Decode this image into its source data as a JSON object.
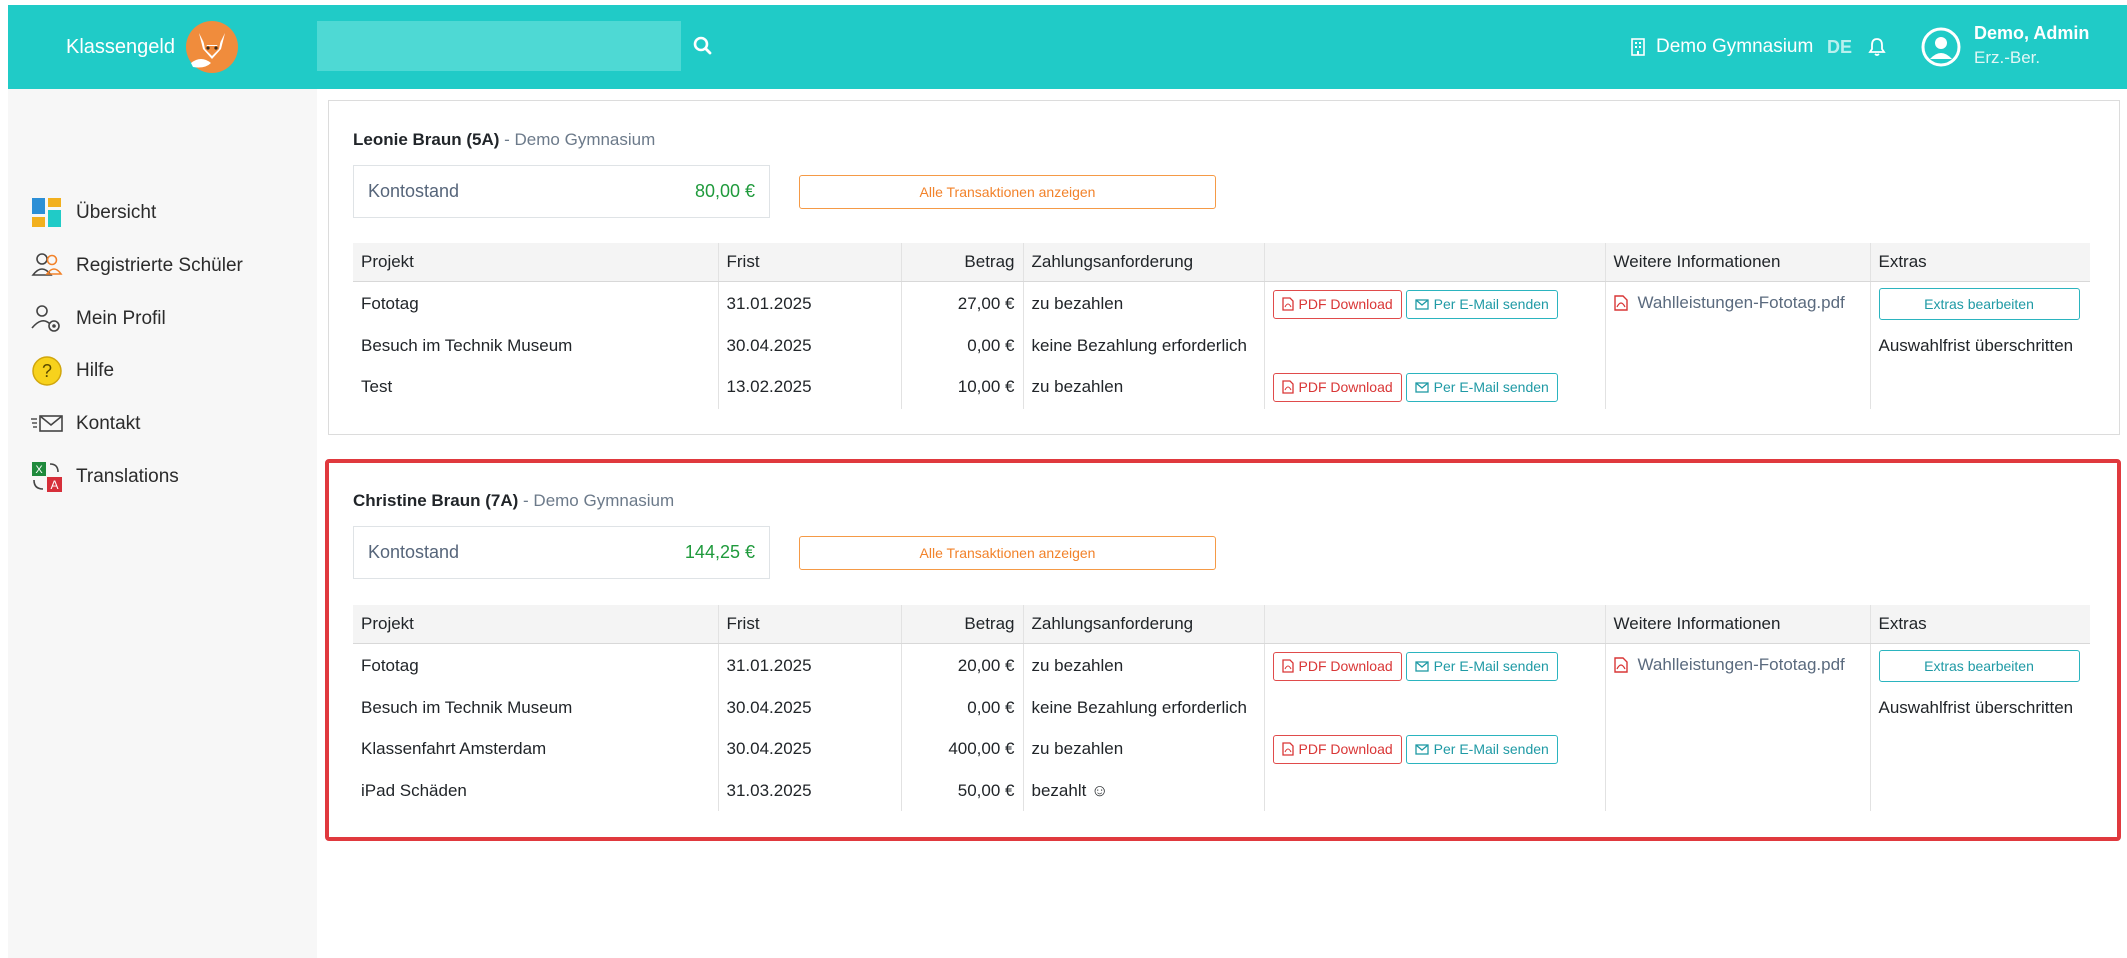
{
  "app": {
    "brand": "Klassengeld"
  },
  "header": {
    "search_placeholder": "",
    "school": "Demo Gymnasium",
    "language": "DE",
    "user_name": "Demo, Admin",
    "user_role": "Erz.-Ber."
  },
  "sidebar": {
    "items": [
      {
        "label": "Übersicht",
        "icon": "dashboard-icon"
      },
      {
        "label": "Registrierte Schüler",
        "icon": "users-icon"
      },
      {
        "label": "Mein Profil",
        "icon": "user-settings-icon"
      },
      {
        "label": "Hilfe",
        "icon": "help-icon"
      },
      {
        "label": "Kontakt",
        "icon": "mail-icon"
      },
      {
        "label": "Translations",
        "icon": "translate-icon"
      }
    ]
  },
  "table_headers": {
    "project": "Projekt",
    "deadline": "Frist",
    "amount": "Betrag",
    "request": "Zahlungsanforderung",
    "actions": "",
    "info": "Weitere Informationen",
    "extras": "Extras"
  },
  "labels": {
    "balance": "Kontostand",
    "all_transactions": "Alle Transaktionen anzeigen",
    "pdf_download": "PDF Download",
    "email_send": "Per E-Mail senden",
    "extras_edit": "Extras bearbeiten",
    "deadline_passed": "Auswahlfrist überschritten"
  },
  "students": [
    {
      "name": "Leonie Braun (5A)",
      "school": "- Demo Gymnasium",
      "balance": "80,00 €",
      "rows": [
        {
          "project": "Fototag",
          "deadline": "31.01.2025",
          "amount": "27,00 €",
          "status": "zu bezahlen"
        },
        {
          "project": "Besuch im Technik Museum",
          "deadline": "30.04.2025",
          "amount": "0,00 €",
          "status": "keine Bezahlung erforderlich"
        },
        {
          "project": "Test",
          "deadline": "13.02.2025",
          "amount": "10,00 €",
          "status": "zu bezahlen"
        }
      ],
      "info_file": "Wahlleistungen-Fototag.pdf"
    },
    {
      "name": "Christine Braun (7A)",
      "school": "- Demo Gymnasium",
      "balance": "144,25 €",
      "rows": [
        {
          "project": "Fototag",
          "deadline": "31.01.2025",
          "amount": "20,00 €",
          "status": "zu bezahlen"
        },
        {
          "project": "Besuch im Technik Museum",
          "deadline": "30.04.2025",
          "amount": "0,00 €",
          "status": "keine Bezahlung erforderlich"
        },
        {
          "project": "Klassenfahrt Amsterdam",
          "deadline": "30.04.2025",
          "amount": "400,00 €",
          "status": "zu bezahlen"
        },
        {
          "project": "iPad Schäden",
          "deadline": "31.03.2025",
          "amount": "50,00 €",
          "status": "bezahlt ☺"
        }
      ],
      "info_file": "Wahlleistungen-Fototag.pdf"
    }
  ],
  "colors": {
    "header": "#20cbc7",
    "due": "#e01b1b",
    "paid": "#1f9a3c",
    "highlight_border": "#e0393e",
    "accent_orange": "#f2822a"
  }
}
